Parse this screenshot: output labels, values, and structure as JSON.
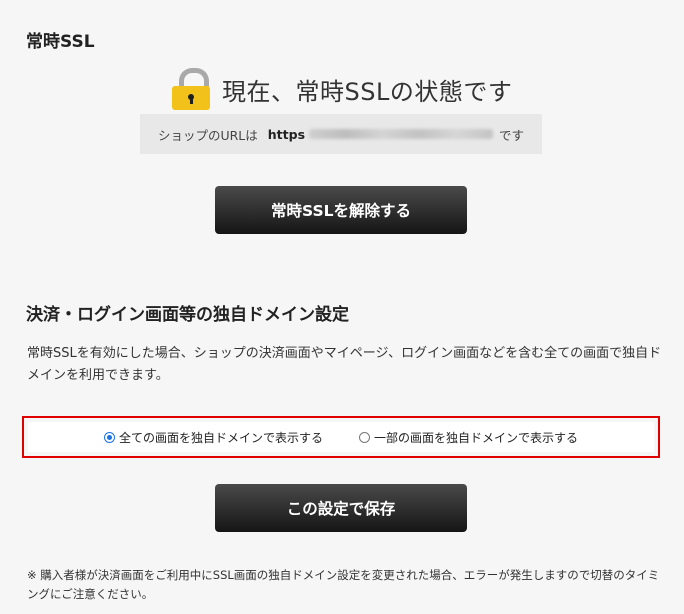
{
  "ssl_section": {
    "title": "常時SSL",
    "status_text": "現在、常時SSLの状態です",
    "url_prefix": "ショップのURLは",
    "url_scheme": "https",
    "url_suffix": "です",
    "release_button_label": "常時SSLを解除する"
  },
  "domain_section": {
    "title": "決済・ログイン画面等の独自ドメイン設定",
    "description": "常時SSLを有効にした場合、ショップの決済画面やマイページ、ログイン画面などを含む全ての画面で独自ドメインを利用できます。",
    "options": [
      {
        "label": "全ての画面を独自ドメインで表示する",
        "checked": true
      },
      {
        "label": "一部の画面を独自ドメインで表示する",
        "checked": false
      }
    ],
    "save_button_label": "この設定で保存",
    "note": "※ 購入者様が決済画面をご利用中にSSL画面の独自ドメイン設定を変更された場合、エラーが発生しますので切替のタイミングにご注意ください。"
  },
  "colors": {
    "highlight_border": "#e00000",
    "button_dark": "#1a1a1a",
    "lock_body": "#f3c21a",
    "radio_selected": "#1a73e8"
  },
  "icons": {
    "lock": "padlock-icon"
  }
}
